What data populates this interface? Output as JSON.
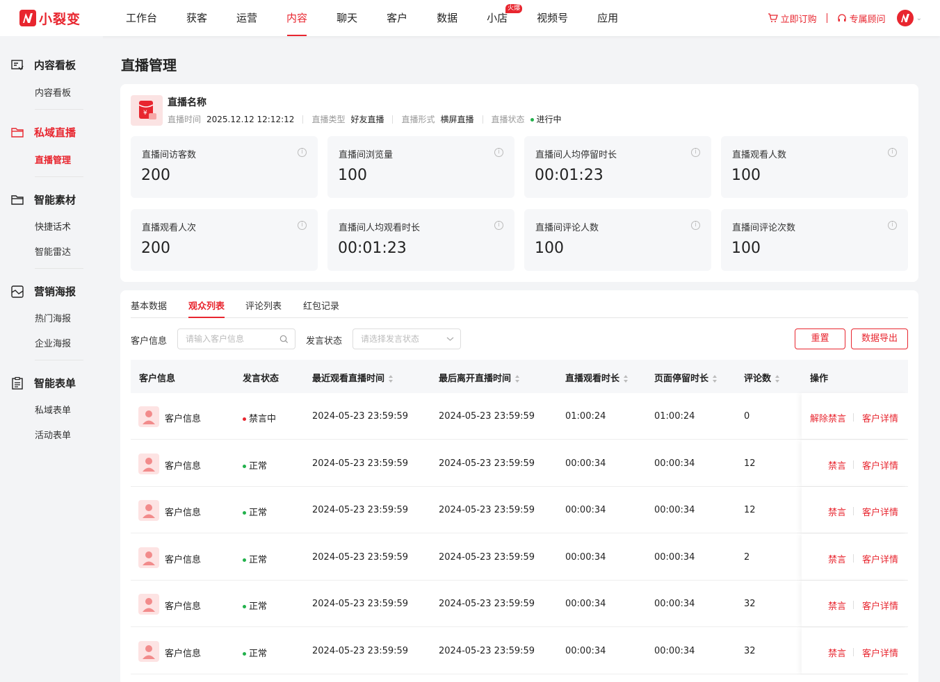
{
  "brand": {
    "name": "小裂变",
    "color": "#e8262f"
  },
  "nav": {
    "items": [
      {
        "label": "工作台"
      },
      {
        "label": "获客"
      },
      {
        "label": "运营"
      },
      {
        "label": "内容",
        "active": true
      },
      {
        "label": "聊天"
      },
      {
        "label": "客户"
      },
      {
        "label": "数据"
      },
      {
        "label": "小店",
        "badge": "火爆"
      },
      {
        "label": "视频号"
      },
      {
        "label": "应用"
      }
    ],
    "right": {
      "order": "立即订购",
      "advisor": "专属顾问"
    }
  },
  "sidebar": {
    "groups": [
      {
        "label": "内容看板",
        "icon": "dashboard-icon",
        "items": [
          "内容看板"
        ]
      },
      {
        "label": "私域直播",
        "icon": "folder-icon",
        "active": true,
        "items": [
          "直播管理"
        ]
      },
      {
        "label": "智能素材",
        "icon": "folder-icon",
        "items": [
          "快捷话术",
          "智能雷达"
        ]
      },
      {
        "label": "营销海报",
        "icon": "poster-icon",
        "items": [
          "热门海报",
          "企业海报"
        ]
      },
      {
        "label": "智能表单",
        "icon": "form-icon",
        "items": [
          "私域表单",
          "活动表单"
        ]
      }
    ]
  },
  "page": {
    "title": "直播管理"
  },
  "live": {
    "name": "直播名称",
    "time_label": "直播时间",
    "time": "2025.12.12 12:12:12",
    "type_label": "直播类型",
    "type": "好友直播",
    "form_label": "直播形式",
    "form": "横屏直播",
    "status_label": "直播状态",
    "status": "进行中"
  },
  "stats": [
    {
      "label": "直播间访客数",
      "value": "200"
    },
    {
      "label": "直播间浏览量",
      "value": "100"
    },
    {
      "label": "直播间人均停留时长",
      "value": "00:01:23"
    },
    {
      "label": "直播观看人数",
      "value": "100"
    },
    {
      "label": "直播观看人次",
      "value": "200"
    },
    {
      "label": "直播间人均观看时长",
      "value": "00:01:23"
    },
    {
      "label": "直播间评论人数",
      "value": "100"
    },
    {
      "label": "直播间评论次数",
      "value": "100"
    }
  ],
  "tabs": [
    {
      "label": "基本数据"
    },
    {
      "label": "观众列表",
      "active": true
    },
    {
      "label": "评论列表"
    },
    {
      "label": "红包记录"
    }
  ],
  "filters": {
    "customer_label": "客户信息",
    "customer_placeholder": "请输入客户信息",
    "status_label": "发言状态",
    "status_placeholder": "请选择发言状态",
    "reset": "重置",
    "export": "数据导出"
  },
  "table": {
    "columns": [
      "客户信息",
      "发言状态",
      "最近观看直播时间",
      "最后离开直播时间",
      "直播观看时长",
      "页面停留时长",
      "评论数",
      "操作"
    ],
    "rows": [
      {
        "customer": "客户信息",
        "status": "禁言中",
        "last_watch": "2024-05-23 23:59:59",
        "last_leave": "2024-05-23 23:59:59",
        "watch": "01:00:24",
        "stay": "01:00:24",
        "comments": "0",
        "action": "解除禁言",
        "detail": "客户详情"
      },
      {
        "customer": "客户信息",
        "status": "正常",
        "last_watch": "2024-05-23 23:59:59",
        "last_leave": "2024-05-23 23:59:59",
        "watch": "00:00:34",
        "stay": "00:00:34",
        "comments": "12",
        "action": "禁言",
        "detail": "客户详情"
      },
      {
        "customer": "客户信息",
        "status": "正常",
        "last_watch": "2024-05-23 23:59:59",
        "last_leave": "2024-05-23 23:59:59",
        "watch": "00:00:34",
        "stay": "00:00:34",
        "comments": "12",
        "action": "禁言",
        "detail": "客户详情"
      },
      {
        "customer": "客户信息",
        "status": "正常",
        "last_watch": "2024-05-23 23:59:59",
        "last_leave": "2024-05-23 23:59:59",
        "watch": "00:00:34",
        "stay": "00:00:34",
        "comments": "2",
        "action": "禁言",
        "detail": "客户详情"
      },
      {
        "customer": "客户信息",
        "status": "正常",
        "last_watch": "2024-05-23 23:59:59",
        "last_leave": "2024-05-23 23:59:59",
        "watch": "00:00:34",
        "stay": "00:00:34",
        "comments": "32",
        "action": "禁言",
        "detail": "客户详情"
      },
      {
        "customer": "客户信息",
        "status": "正常",
        "last_watch": "2024-05-23 23:59:59",
        "last_leave": "2024-05-23 23:59:59",
        "watch": "00:00:34",
        "stay": "00:00:34",
        "comments": "32",
        "action": "禁言",
        "detail": "客户详情"
      }
    ]
  },
  "colors": {
    "muted_status": "#e8262f",
    "normal_status": "#22b14c",
    "live_status": "#22b14c"
  }
}
